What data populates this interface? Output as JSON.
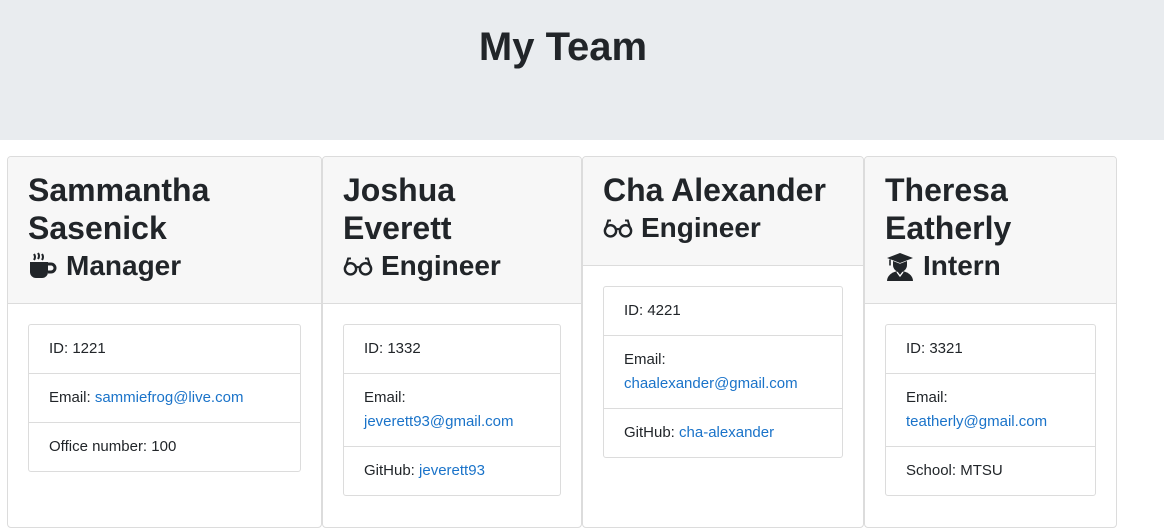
{
  "header": {
    "title": "My Team"
  },
  "cards": [
    {
      "name_line1": "Sammantha",
      "name_line2": "Sasenick",
      "role": "Manager",
      "role_icon": "mug-icon",
      "id_label": "ID: ",
      "id": "1221",
      "email_label": "Email: ",
      "email": "sammiefrog@live.com",
      "extra_label": "Office number: ",
      "extra_value": "100"
    },
    {
      "name_line1": "Joshua Everett",
      "role": "Engineer",
      "role_icon": "glasses-icon",
      "id_label": "ID: ",
      "id": "1332",
      "email_label": "Email:",
      "email": "jeverett93@gmail.com",
      "extra_label": "GitHub: ",
      "extra_value": "jeverett93"
    },
    {
      "name_line1": "Cha Alexander",
      "role": "Engineer",
      "role_icon": "glasses-icon",
      "id_label": "ID: ",
      "id": "4221",
      "email_label": "Email:",
      "email": "chaalexander@gmail.com",
      "extra_label": "GitHub: ",
      "extra_value": "cha-alexander"
    },
    {
      "name_line1": "Theresa",
      "name_line2": "Eatherly",
      "role": "Intern",
      "role_icon": "graduate-icon",
      "id_label": "ID: ",
      "id": "3321",
      "email_label": "Email:",
      "email": "teatherly@gmail.com",
      "extra_label": "School: ",
      "extra_value": "MTSU"
    }
  ],
  "colors": {
    "link": "#1a73c9",
    "jumbotron": "#e9ecef",
    "header_bg": "#f7f7f7"
  }
}
